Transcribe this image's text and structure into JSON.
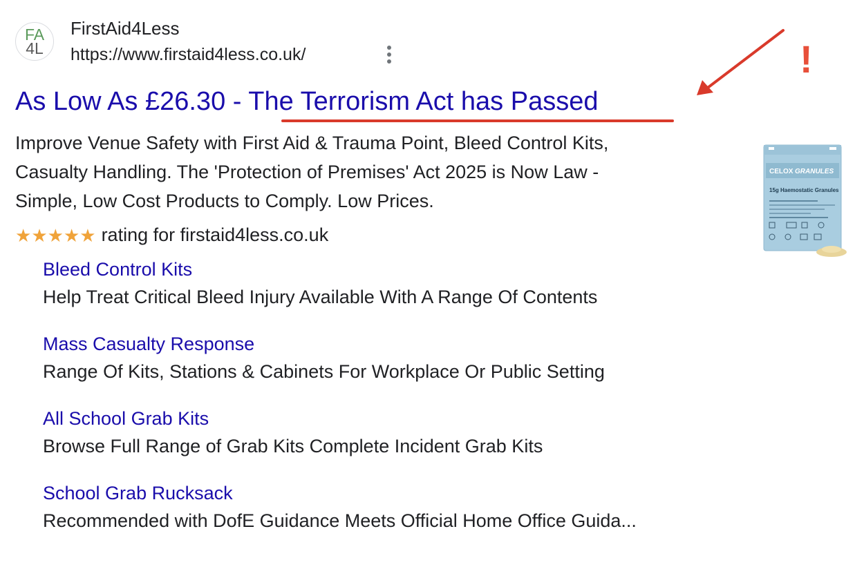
{
  "result": {
    "favicon_lines": [
      "FA",
      "4L"
    ],
    "site_name": "FirstAid4Less",
    "site_url": "https://www.firstaid4less.co.uk/",
    "headline_part1": "As Low As £26.30 - ",
    "headline_part2": "The Terrorism Act has Passed",
    "description_lines": [
      "Improve Venue Safety with First Aid & Trauma Point, Bleed Control Kits,",
      "Casualty Handling. The 'Protection of Premises' Act 2025 is Now Law -",
      "Simple, Low Cost Products to Comply. Low Prices."
    ],
    "rating_stars": 5,
    "rating_text": "rating for firstaid4less.co.uk",
    "product_image": {
      "brand": "CELOX",
      "product": "GRANULES",
      "subtitle": "15g Haemostatic Granules"
    }
  },
  "sitelinks": [
    {
      "title": "Bleed Control Kits",
      "description": "Help Treat Critical Bleed Injury Available With A Range Of Contents"
    },
    {
      "title": "Mass Casualty Response",
      "description": "Range Of Kits, Stations & Cabinets For Workplace Or Public Setting"
    },
    {
      "title": "All School Grab Kits",
      "description": "Browse Full Range of Grab Kits Complete Incident Grab Kits"
    },
    {
      "title": "School Grab Rucksack",
      "description": "Recommended with DofE Guidance Meets Official Home Office Guida..."
    }
  ],
  "annotations": {
    "exclamation": "!",
    "accent_color": "#d93a2b"
  },
  "colors": {
    "link": "#1a0dab",
    "text": "#202124",
    "star": "#f0a33a"
  }
}
